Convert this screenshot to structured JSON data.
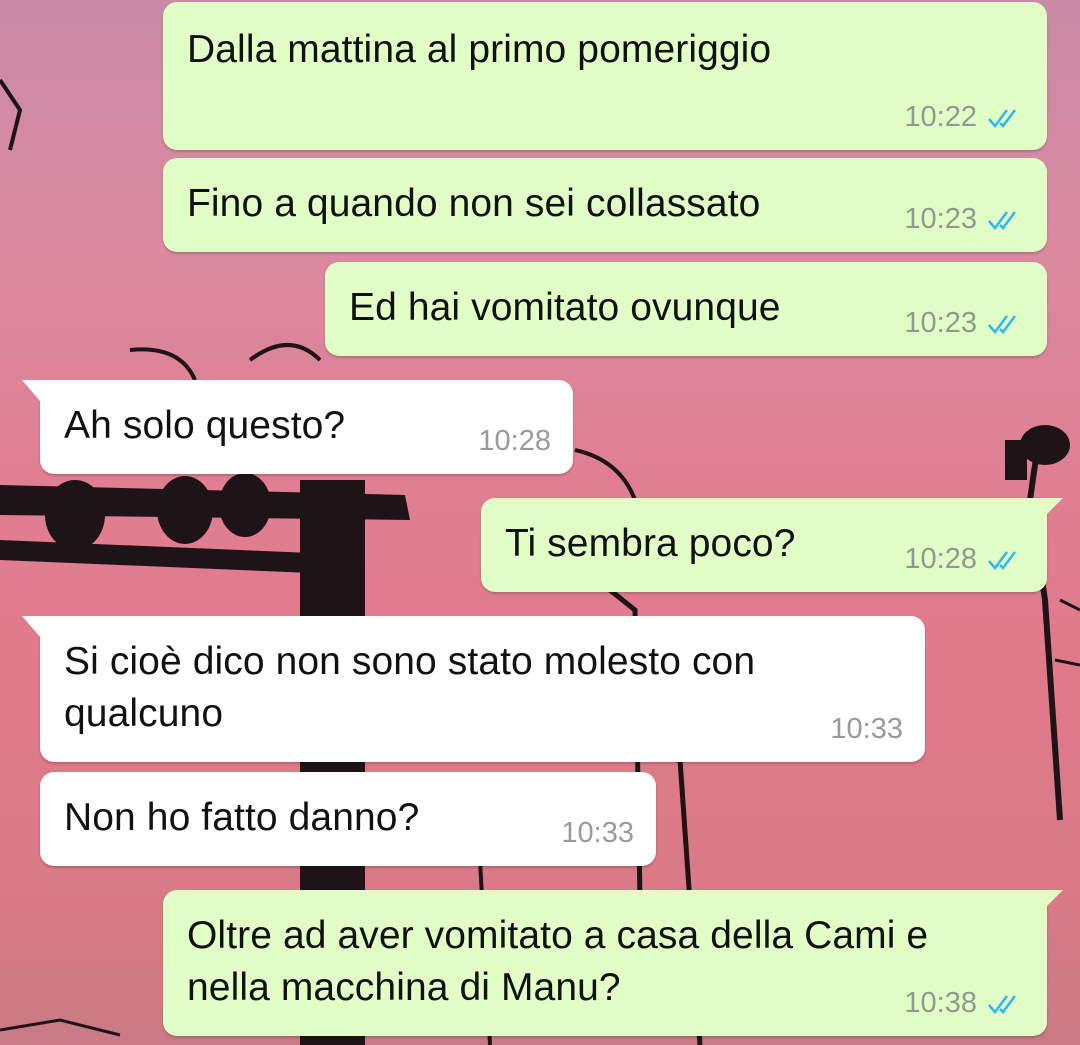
{
  "colors": {
    "outgoing_bubble": "#e1fec6",
    "incoming_bubble": "#ffffff",
    "read_ticks": "#34b7f1",
    "sky_top": "#c98aa6",
    "sky_bottom": "#d97a86"
  },
  "messages": [
    {
      "direction": "outgoing",
      "text": "Dalla mattina al primo pomeriggio",
      "time": "10:22",
      "status": "read-double-check-icon"
    },
    {
      "direction": "outgoing",
      "text": "Fino a quando non sei collassato",
      "time": "10:23",
      "status": "read-double-check-icon"
    },
    {
      "direction": "outgoing",
      "text": "Ed hai vomitato ovunque",
      "time": "10:23",
      "status": "read-double-check-icon"
    },
    {
      "direction": "incoming",
      "text": "Ah solo questo?",
      "time": "10:28"
    },
    {
      "direction": "outgoing",
      "text": "Ti sembra poco?",
      "time": "10:28",
      "status": "read-double-check-icon"
    },
    {
      "direction": "incoming",
      "text": "Si cioè dico non sono stato molesto con\nqualcuno",
      "time": "10:33"
    },
    {
      "direction": "incoming",
      "text": "Non ho fatto danno?",
      "time": "10:33"
    },
    {
      "direction": "outgoing",
      "text": "Oltre ad aver vomitato a casa della Cami e\nnella macchina di Manu?",
      "time": "10:38",
      "status": "read-double-check-icon"
    }
  ]
}
